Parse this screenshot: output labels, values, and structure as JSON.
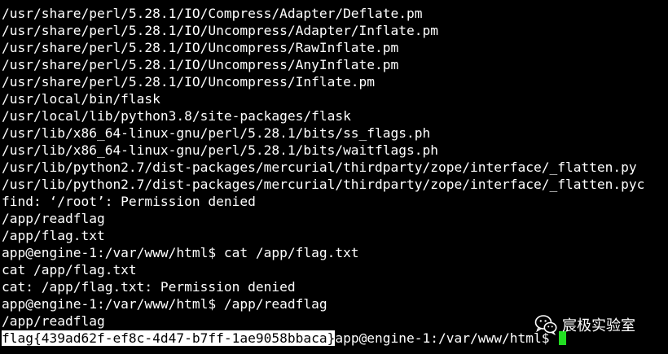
{
  "terminal": {
    "lines": [
      "/usr/share/perl/5.28.1/IO/Compress/Adapter/Deflate.pm",
      "/usr/share/perl/5.28.1/IO/Uncompress/Adapter/Inflate.pm",
      "/usr/share/perl/5.28.1/IO/Uncompress/RawInflate.pm",
      "/usr/share/perl/5.28.1/IO/Uncompress/AnyInflate.pm",
      "/usr/share/perl/5.28.1/IO/Uncompress/Inflate.pm",
      "/usr/local/bin/flask",
      "/usr/local/lib/python3.8/site-packages/flask",
      "/usr/lib/x86_64-linux-gnu/perl/5.28.1/bits/ss_flags.ph",
      "/usr/lib/x86_64-linux-gnu/perl/5.28.1/bits/waitflags.ph",
      "/usr/lib/python2.7/dist-packages/mercurial/thirdparty/zope/interface/_flatten.py",
      "/usr/lib/python2.7/dist-packages/mercurial/thirdparty/zope/interface/_flatten.pyc",
      "find: ‘/root’: Permission denied",
      "/app/readflag",
      "/app/flag.txt",
      "app@engine-1:/var/www/html$ cat /app/flag.txt",
      "cat /app/flag.txt",
      "cat: /app/flag.txt: Permission denied",
      "app@engine-1:/var/www/html$ /app/readflag",
      "/app/readflag"
    ],
    "last_line": {
      "flag": "flag{439ad62f-ef8c-4d47-b7ff-1ae9058bbaca}",
      "prompt": "app@engine-1:/var/www/html$ "
    }
  },
  "watermark": {
    "text": "宸极实验室",
    "icon": "wechat-icon"
  },
  "colors": {
    "background": "#000000",
    "foreground": "#ffffff",
    "cursor": "#22dd22",
    "highlight_bg": "#ffffff",
    "highlight_fg": "#000000"
  }
}
